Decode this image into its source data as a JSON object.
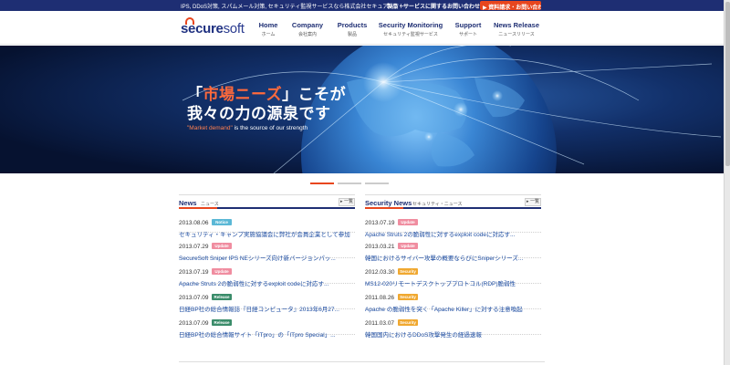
{
  "topbar": {
    "tagline": "IPS, DDoS対策, スパムメール対策, セキュリティ監視サービスなら株式会社セキュアソフト",
    "contact": "製品・サービスに関するお問い合わせはこちら",
    "request_button": "▶ 資料請求・お問い合わせ"
  },
  "logo": {
    "part1": "s",
    "part2": "ecure",
    "part3": "soft"
  },
  "nav": [
    {
      "en": "Home",
      "jp": "ホーム"
    },
    {
      "en": "Company",
      "jp": "会社案内"
    },
    {
      "en": "Products",
      "jp": "製品"
    },
    {
      "en": "Security Monitoring",
      "jp": "セキュリティ監視サービス"
    },
    {
      "en": "Support",
      "jp": "サポート"
    },
    {
      "en": "News Release",
      "jp": "ニュースリリース"
    }
  ],
  "hero": {
    "title1_open": "「",
    "title1_highlight": "市場ニーズ",
    "title1_close": "」こそが",
    "title2": "我々の力の源泉です",
    "sub_highlight": "\"Market demand\"",
    "sub_rest": " is the source of our strength"
  },
  "news": {
    "title": "News",
    "title_jp": "ニュース",
    "list_button": "▸ 一覧",
    "items": [
      {
        "date": "2013.08.06",
        "badge": "Notice",
        "title": "セキュリティ・キャンプ実施協議会に弊社が会員企業として参加"
      },
      {
        "date": "2013.07.29",
        "badge": "Update",
        "title": "SecureSoft Sniper IPS NEシリーズ向け新バージョンパッ..."
      },
      {
        "date": "2013.07.19",
        "badge": "Update",
        "title": "Apache Struts 2の脆弱性に対するexploit codeに対応す..."
      },
      {
        "date": "2013.07.09",
        "badge": "Release",
        "title": "日経BP社の総合情報誌『日経コンピュータ』2013年6月27..."
      },
      {
        "date": "2013.07.09",
        "badge": "Release",
        "title": "日経BP社の総合情報サイト「ITpro」の「ITpro Special」..."
      }
    ]
  },
  "security_news": {
    "title": "Security News",
    "title_jp": "セキュリティ・ニュース",
    "list_button": "▸ 一覧",
    "items": [
      {
        "date": "2013.07.19",
        "badge": "Update",
        "title": "Apache Struts 2の脆弱性に対するexploit codeに対応す..."
      },
      {
        "date": "2013.03.21",
        "badge": "Update",
        "title": "韓国におけるサイバー攻撃の概要ならびにSniperシリーズ..."
      },
      {
        "date": "2012.03.30",
        "badge": "Security",
        "title": "MS12-020リモートデスクトッププロトコル(RDP)脆弱性"
      },
      {
        "date": "2011.08.26",
        "badge": "Security",
        "title": "Apache の脆弱性を突く「Apache Killer」に対する注意喚起"
      },
      {
        "date": "2011.03.07",
        "badge": "Security",
        "title": "韓国国内におけるDDoS攻撃発生の経過速報"
      }
    ]
  },
  "colors": {
    "navy": "#1e2e73",
    "accent": "#e8461e",
    "notice": "#5bb8d6",
    "update": "#f08da0",
    "release": "#3a8c6a",
    "security": "#f0a830"
  }
}
